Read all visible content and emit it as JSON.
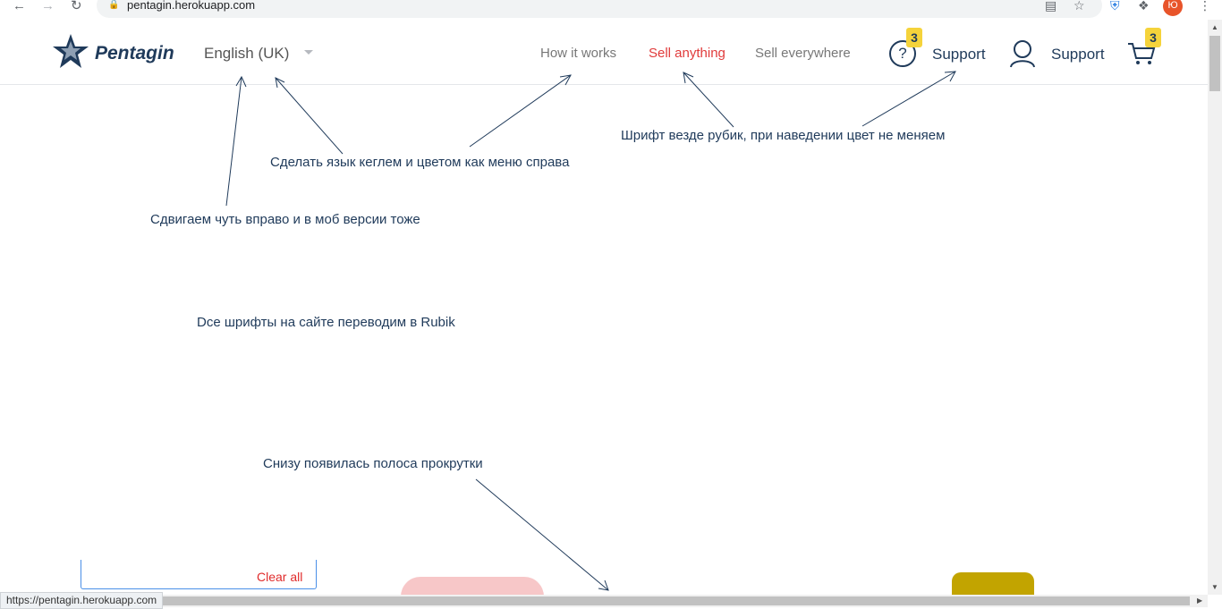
{
  "browser": {
    "url": "pentagin.herokuapp.com",
    "status_url": "https://pentagin.herokuapp.com",
    "profile_initial": "Ю"
  },
  "header": {
    "logo_text": "Pentagin",
    "language": "English (UK)",
    "menu": [
      {
        "label": "How it works",
        "active": false
      },
      {
        "label": "Sell anything",
        "active": true
      },
      {
        "label": "Sell everywhere",
        "active": false
      }
    ],
    "help_badge": "3",
    "support_label_1": "Support",
    "support_label_2": "Support",
    "cart_badge": "3"
  },
  "annotations": [
    "Шрифт везде рубик, при наведении цвет не меняем",
    "Сделать язык кеглем и цветом как меню справа",
    "Сдвигаем чуть вправо и в моб версии тоже",
    "Dсе шрифты на сайте переводим в Rubik",
    "Снизу появилась полоса прокрутки"
  ],
  "content": {
    "clear_all": "Clear all"
  },
  "colors": {
    "brand_navy": "#1f3a5a",
    "active_menu": "#e03a3a",
    "badge_yellow": "#f5d33b",
    "clear_all_red": "#e02b2b"
  }
}
